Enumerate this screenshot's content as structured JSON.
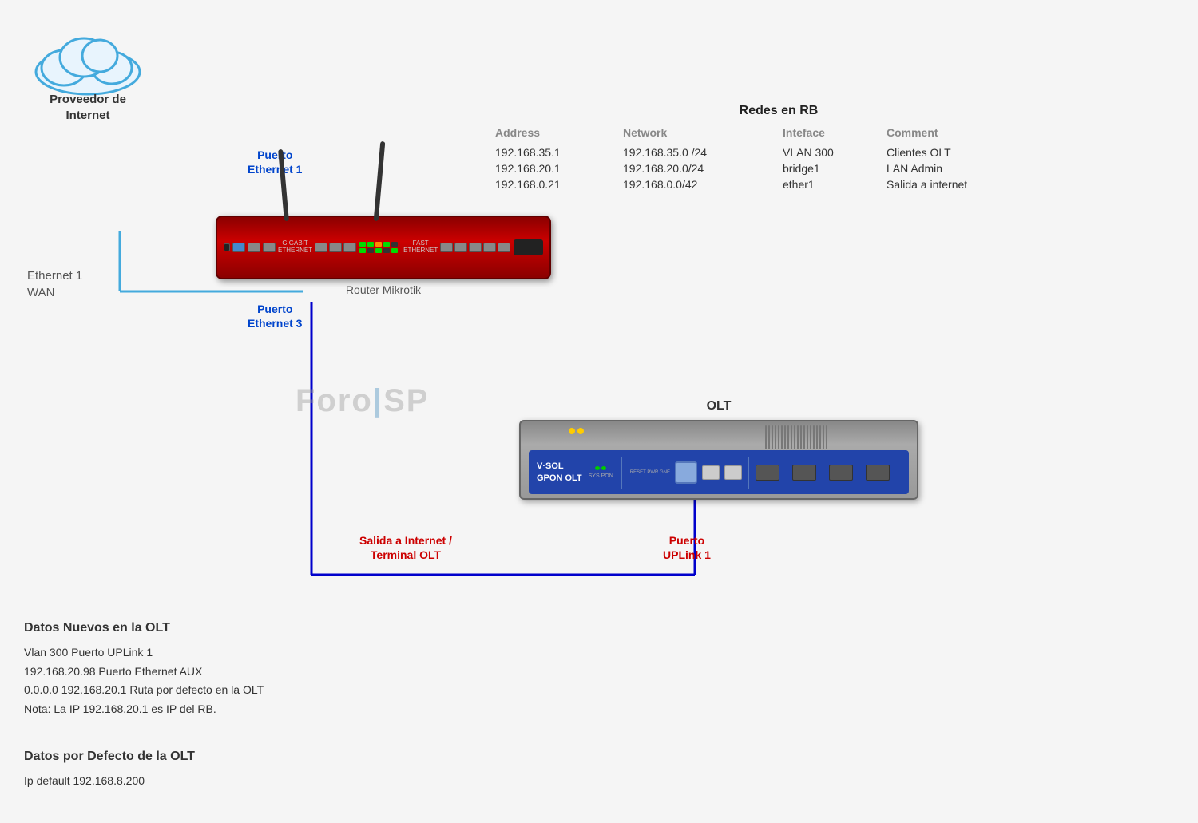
{
  "cloud": {
    "label_line1": "Proveedor de",
    "label_line2": "Internet"
  },
  "router": {
    "label": "Router Mikrotik"
  },
  "olt": {
    "title": "OLT",
    "brand_line1": "V·SOL",
    "brand_line2": "GPON OLT"
  },
  "puertos": {
    "eth1_line1": "Puerto",
    "eth1_line2": "Ethernet 1",
    "eth3_line1": "Puerto",
    "eth3_line2": "Ethernet 3",
    "salida_line1": "Salida a Internet /",
    "salida_line2": "Terminal  OLT",
    "uplink_line1": "Puerto",
    "uplink_line2": "UPLink 1"
  },
  "wan_label": {
    "line1": "Ethernet 1",
    "line2": "WAN"
  },
  "redes": {
    "title": "Redes en RB",
    "headers": [
      "Address",
      "Network",
      "Inteface",
      "Comment"
    ],
    "rows": [
      [
        "192.168.35.1",
        "192.168.35.0 /24",
        "VLAN 300",
        "Clientes OLT"
      ],
      [
        "192.168.20.1",
        "192.168.20.0/24",
        "bridge1",
        "LAN Admin"
      ],
      [
        "192.168.0.21",
        "192.168.0.0/42",
        "ether1",
        "Salida a internet"
      ]
    ]
  },
  "datos_nuevos": {
    "title": "Datos Nuevos en  la OLT",
    "line1": "Vlan 300           Puerto UPLink 1",
    "line2": "192.168.20.98    Puerto Ethernet AUX",
    "line3": "0.0.0.0              192.168.20.1    Ruta  por defecto en la OLT",
    "line4": "Nota: La IP 192.168.20.1 es IP del RB."
  },
  "datos_defecto": {
    "title": "Datos por Defecto de la OLT",
    "line1": "Ip default            192.168.8.200"
  },
  "watermark": "Foro|SP"
}
